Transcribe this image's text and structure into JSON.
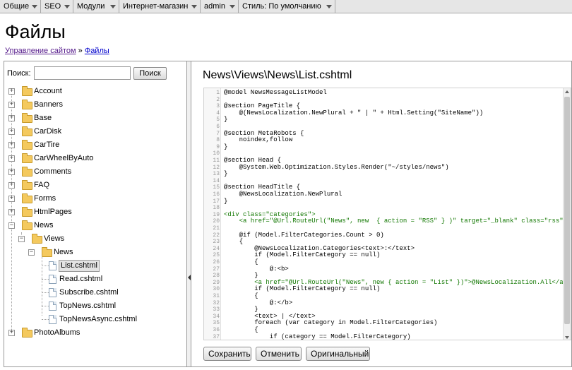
{
  "menu": [
    {
      "label": "Общие"
    },
    {
      "label": "SEO"
    },
    {
      "label": "Модули"
    },
    {
      "label": "Интернет-магазин"
    },
    {
      "label": "admin"
    },
    {
      "label": "Стиль: По умолчанию"
    }
  ],
  "page": {
    "title": "Файлы"
  },
  "breadcrumb": {
    "root": "Управление сайтом",
    "sep": "»",
    "current": "Файлы"
  },
  "search": {
    "label": "Поиск:",
    "value": "",
    "placeholder": "",
    "button": "Поиск"
  },
  "tree": {
    "folders": [
      "Account",
      "Banners",
      "Base",
      "CarDisk",
      "CarTire",
      "CarWheelByAuto",
      "Comments",
      "FAQ",
      "Forms",
      "HtmlPages",
      "News"
    ],
    "news_children": {
      "views": "Views",
      "news": "News"
    },
    "files": [
      "List.cshtml",
      "Read.cshtml",
      "Subscribe.cshtml",
      "TopNews.cshtml",
      "TopNewsAsync.cshtml"
    ],
    "selected_file": "List.cshtml",
    "last_folder": "PhotoAlbums"
  },
  "editor": {
    "path": "News\\Views\\News\\List.cshtml",
    "lines": [
      {
        "n": "1",
        "t": "@model NewsMessageListModel"
      },
      {
        "n": "2",
        "t": ""
      },
      {
        "n": "3",
        "t": "@section PageTitle {"
      },
      {
        "n": "4",
        "t": "    @(NewsLocalization.NewPlural + \" | \" + Html.Setting(\"SiteName\"))"
      },
      {
        "n": "5",
        "t": "}"
      },
      {
        "n": "6",
        "t": ""
      },
      {
        "n": "7",
        "t": "@section MetaRobots {"
      },
      {
        "n": "8",
        "t": "    noindex,follow"
      },
      {
        "n": "9",
        "t": "}"
      },
      {
        "n": "10",
        "t": ""
      },
      {
        "n": "11",
        "t": "@section Head {"
      },
      {
        "n": "12",
        "t": "    @System.Web.Optimization.Styles.Render(\"~/styles/news\")"
      },
      {
        "n": "13",
        "t": "}"
      },
      {
        "n": "14",
        "t": ""
      },
      {
        "n": "15",
        "t": "@section HeadTitle {"
      },
      {
        "n": "16",
        "t": "    @NewsLocalization.NewPlural"
      },
      {
        "n": "17",
        "t": "}"
      },
      {
        "n": "18",
        "t": ""
      },
      {
        "n": "19",
        "t": "<div class=\"categories\">"
      },
      {
        "n": "20",
        "t": "    <a href=\"@Url.RouteUrl(\"News\", new  { action = \"RSS\" } )\" target=\"_blank\" class=\"rss\"><im"
      },
      {
        "n": "21",
        "t": ""
      },
      {
        "n": "22",
        "t": "    @if (Model.FilterCategories.Count > 0)"
      },
      {
        "n": "23",
        "t": "    {"
      },
      {
        "n": "24",
        "t": "        @NewsLocalization.Categories<text>:</text>"
      },
      {
        "n": "25",
        "t": "        if (Model.FilterCategory == null)"
      },
      {
        "n": "26",
        "t": "        {"
      },
      {
        "n": "27",
        "t": "            @:<b>"
      },
      {
        "n": "28",
        "t": "        }"
      },
      {
        "n": "29",
        "t": "        <a href=\"@Url.RouteUrl(\"News\", new { action = \"List\" })\">@NewsLocalization.All</a>"
      },
      {
        "n": "30",
        "t": "        if (Model.FilterCategory == null)"
      },
      {
        "n": "31",
        "t": "        {"
      },
      {
        "n": "32",
        "t": "            @:</b>"
      },
      {
        "n": "33",
        "t": "        }"
      },
      {
        "n": "34",
        "t": "        <text> | </text>"
      },
      {
        "n": "35",
        "t": "        foreach (var category in Model.FilterCategories)"
      },
      {
        "n": "36",
        "t": "        {"
      },
      {
        "n": "37",
        "t": "            if (category == Model.FilterCategory)"
      }
    ]
  },
  "actions": {
    "save": "Сохранить",
    "cancel": "Отменить",
    "original": "Оригинальный"
  },
  "colors": {
    "menu_bg": "#e6e6e6",
    "folder": "#f4c95e",
    "code_tag": "#117700",
    "code_attr": "#0000cc"
  }
}
